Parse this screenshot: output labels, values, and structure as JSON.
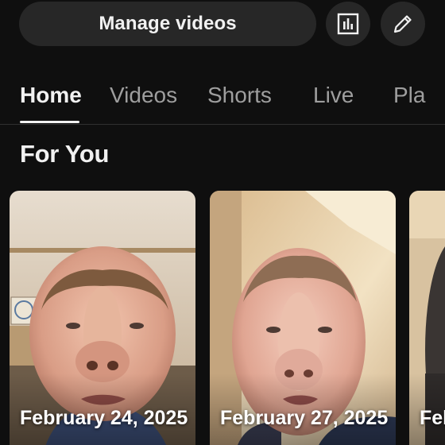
{
  "header": {
    "manage_label": "Manage videos",
    "analytics_icon": "bar-chart-icon",
    "edit_icon": "pencil-icon"
  },
  "tabs": [
    {
      "label": "Home",
      "active": true
    },
    {
      "label": "Videos",
      "active": false
    },
    {
      "label": "Shorts",
      "active": false
    },
    {
      "label": "Live",
      "active": false
    },
    {
      "label": "Pla",
      "active": false
    }
  ],
  "section": {
    "title": "For You"
  },
  "cards": [
    {
      "date": "February 24, 2025",
      "subtitle": "",
      "thumbnail": "face-filter-photo-wall-background"
    },
    {
      "date": "February 27, 2025",
      "subtitle": "",
      "thumbnail": "face-filter-photo-ceiling-background"
    },
    {
      "date": "Feb",
      "subtitle": "",
      "thumbnail": "dark-photo"
    }
  ],
  "colors": {
    "background": "#0f0f0f",
    "chip": "#272727",
    "text_primary": "#f1f1f1",
    "text_secondary": "#9e9e9e"
  }
}
